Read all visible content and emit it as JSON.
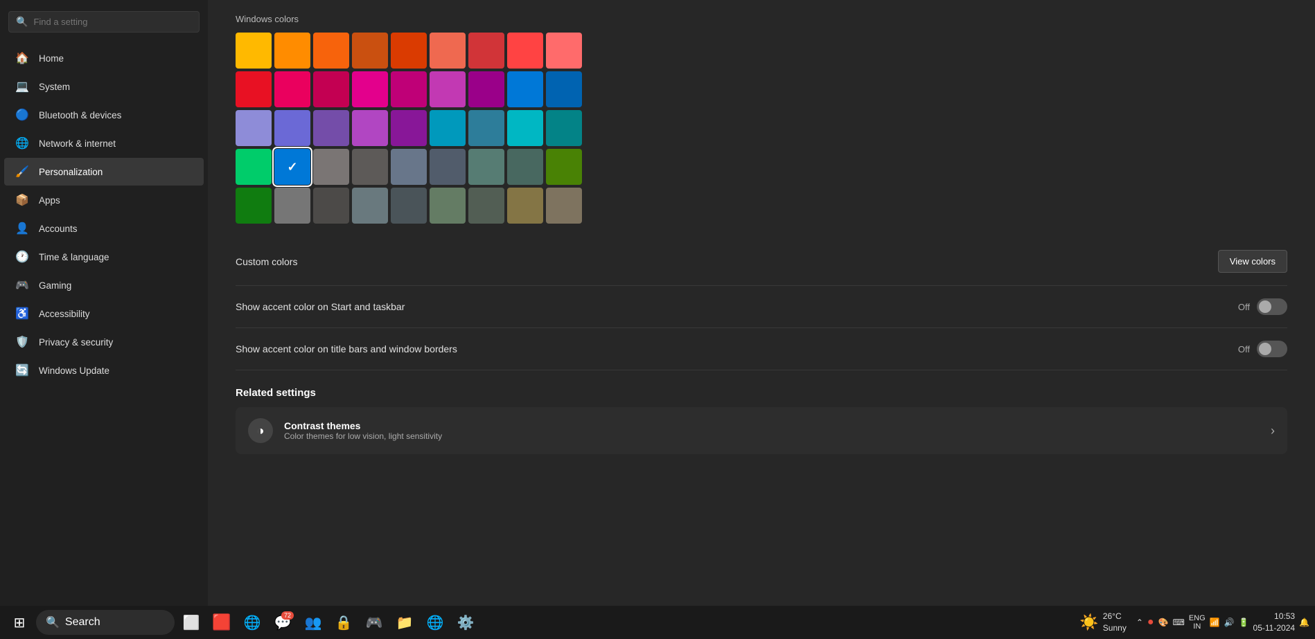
{
  "sidebar": {
    "search_placeholder": "Find a setting",
    "items": [
      {
        "id": "home",
        "label": "Home",
        "icon": "🏠"
      },
      {
        "id": "system",
        "label": "System",
        "icon": "💻"
      },
      {
        "id": "bluetooth",
        "label": "Bluetooth & devices",
        "icon": "🔵"
      },
      {
        "id": "network",
        "label": "Network & internet",
        "icon": "🌐"
      },
      {
        "id": "personalization",
        "label": "Personalization",
        "icon": "🖌️",
        "active": true
      },
      {
        "id": "apps",
        "label": "Apps",
        "icon": "📦"
      },
      {
        "id": "accounts",
        "label": "Accounts",
        "icon": "👤"
      },
      {
        "id": "time",
        "label": "Time & language",
        "icon": "🕐"
      },
      {
        "id": "gaming",
        "label": "Gaming",
        "icon": "🎮"
      },
      {
        "id": "accessibility",
        "label": "Accessibility",
        "icon": "♿"
      },
      {
        "id": "privacy",
        "label": "Privacy & security",
        "icon": "🛡️"
      },
      {
        "id": "windows-update",
        "label": "Windows Update",
        "icon": "🔄"
      }
    ]
  },
  "main": {
    "section_title": "Windows colors",
    "colors": [
      "#FFB900",
      "#FF8C00",
      "#F7630C",
      "#CA5010",
      "#DA3B01",
      "#EF6950",
      "#D13438",
      "#FF4343",
      "#FF6B6B",
      "#E81123",
      "#EA005E",
      "#C30052",
      "#E3008C",
      "#BF0077",
      "#C239B3",
      "#9A0089",
      "#0078D7",
      "#0063B1",
      "#8E8CD8",
      "#6B69D6",
      "#744DA9",
      "#B146C2",
      "#881798",
      "#0099BC",
      "#2D7D9A",
      "#00B7C3",
      "#038387",
      "#00CC6A",
      "#10893E",
      "#7A7574",
      "#5D5A58",
      "#68768A",
      "#515C6B",
      "#567C73",
      "#486860",
      "#498205",
      "#107C10",
      "#767676",
      "#4C4A48",
      "#69797E",
      "#4A5459",
      "#647C64",
      "#525E54",
      "#847545",
      "#7E735F"
    ],
    "selected_color_index": 28,
    "custom_colors_label": "Custom colors",
    "view_colors_button": "View colors",
    "show_accent_start_label": "Show accent color on Start and taskbar",
    "show_accent_start_value": "Off",
    "show_accent_title_label": "Show accent color on title bars and window borders",
    "show_accent_title_value": "Off",
    "related_settings_title": "Related settings",
    "contrast_themes_title": "Contrast themes",
    "contrast_themes_desc": "Color themes for low vision, light sensitivity"
  },
  "taskbar": {
    "search_label": "Search",
    "time": "10:53",
    "date": "05-11-2024",
    "weather_temp": "26°C",
    "weather_condition": "Sunny",
    "language": "ENG\nIN"
  }
}
